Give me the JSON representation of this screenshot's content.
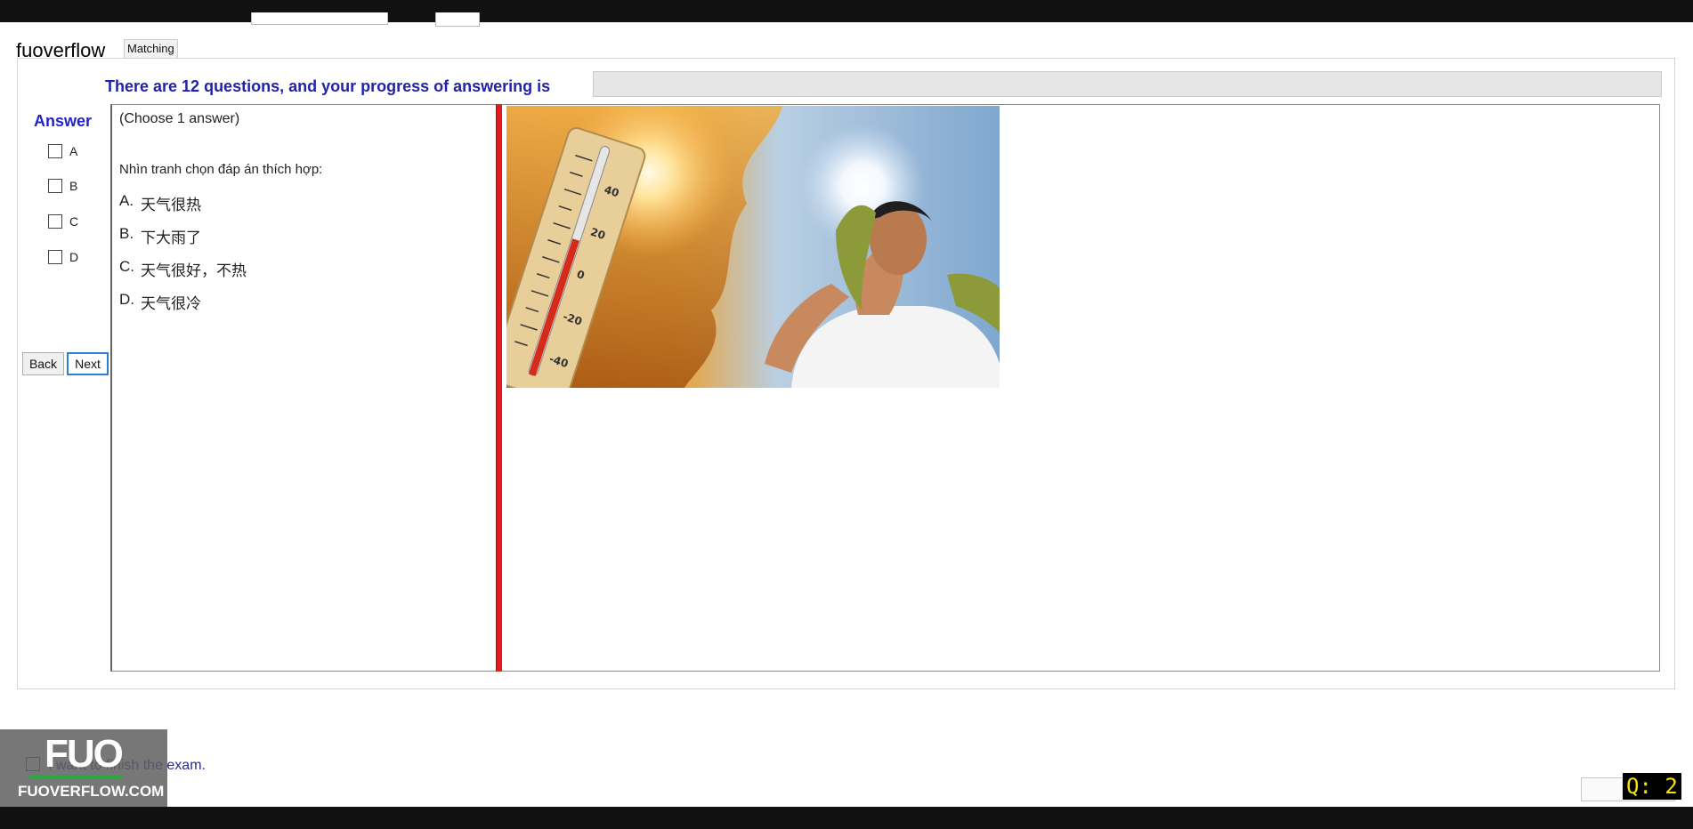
{
  "app": {
    "brand": "fuoverflow",
    "tab_label": "Matching"
  },
  "progress": {
    "label": "There are 12 questions, and your progress of answering is",
    "value": 0
  },
  "answer_panel": {
    "heading": "Answer",
    "options": [
      "A",
      "B",
      "C",
      "D"
    ]
  },
  "nav": {
    "back_label": "Back",
    "next_label": "Next"
  },
  "question": {
    "choose_note": "(Choose 1 answer)",
    "instruction": "Nhìn tranh chọn đáp án thích hợp:",
    "options": [
      {
        "letter": "A.",
        "text": "天气很热"
      },
      {
        "letter": "B.",
        "text": "下大雨了"
      },
      {
        "letter": "C.",
        "text": "天气很好，不热"
      },
      {
        "letter": "D.",
        "text": "天气很冷"
      }
    ],
    "thermometer_marks": [
      "40",
      "20",
      "0",
      "-20",
      "-40"
    ]
  },
  "footer": {
    "finish_text": "I want to finish the exam.",
    "watermark_logo": "FUO",
    "watermark_text": "FUOVERFLOW.COM",
    "question_badge": "Q: 2"
  },
  "colors": {
    "accent_blue": "#2222aa",
    "splitter_red": "#e11c1c",
    "badge_yellow": "#f2e600"
  }
}
